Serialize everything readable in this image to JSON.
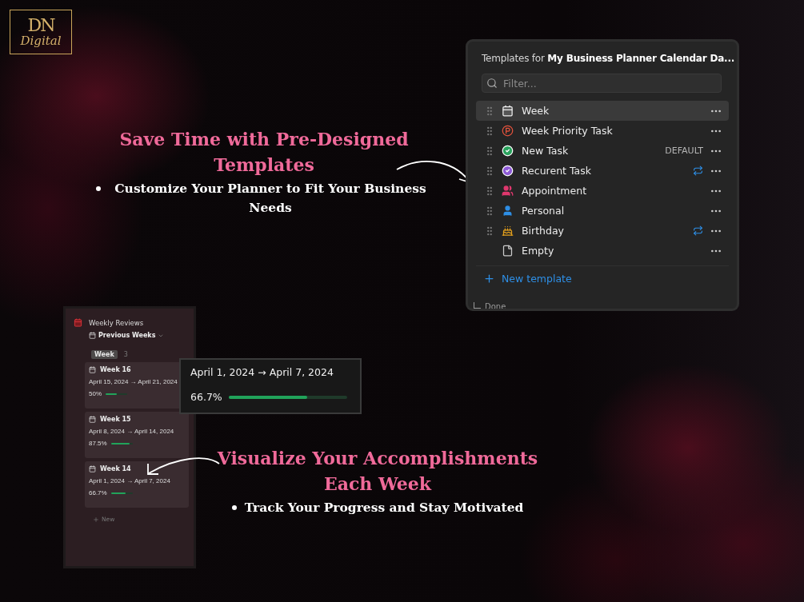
{
  "logo": {
    "monogram": "DN",
    "wordmark": "Digital"
  },
  "feature_1": {
    "heading": "Save Time with Pre-Designed Templates",
    "bullets": [
      "Customize Your Planner to Fit Your Business Needs"
    ]
  },
  "templates_panel": {
    "title_prefix": "Templates for",
    "title_database": "My Business Planner Calendar Da...",
    "filter": {
      "placeholder": "Filter..."
    },
    "templates": [
      {
        "label": "Week",
        "kind": "calendar",
        "selected": true,
        "draggable": true,
        "repeats": false
      },
      {
        "label": "Week Priority Task",
        "kind": "priority",
        "selected": false,
        "draggable": true,
        "repeats": false
      },
      {
        "label": "New Task",
        "kind": "task",
        "selected": false,
        "draggable": true,
        "repeats": false,
        "badge": "DEFAULT"
      },
      {
        "label": "Recurent Task",
        "kind": "recurring",
        "selected": false,
        "draggable": true,
        "repeats": true
      },
      {
        "label": "Appointment",
        "kind": "people",
        "selected": false,
        "draggable": true,
        "repeats": false
      },
      {
        "label": "Personal",
        "kind": "person",
        "selected": false,
        "draggable": true,
        "repeats": false
      },
      {
        "label": "Birthday",
        "kind": "cake",
        "selected": false,
        "draggable": true,
        "repeats": true
      },
      {
        "label": "Empty",
        "kind": "page",
        "selected": false,
        "draggable": false,
        "repeats": false
      }
    ],
    "new_template": "New template",
    "behind_text": "Done"
  },
  "weekly_panel": {
    "title": "Weekly Reviews",
    "view": "Previous Weeks",
    "group": {
      "label": "Week",
      "count": "3"
    },
    "cards": [
      {
        "title": "Week 16",
        "dates": "April 15, 2024 → April 21, 2024",
        "percent": "50%",
        "level": 0.5
      },
      {
        "title": "Week 15",
        "dates": "April 8, 2024 → April 14, 2024",
        "percent": "87.5%",
        "level": 0.875
      },
      {
        "title": "Week 14",
        "dates": "April 1, 2024 → April 7, 2024",
        "percent": "66.7%",
        "level": 0.667
      }
    ],
    "new": "New"
  },
  "zoom_card": {
    "dates": "April 1, 2024 → April 7, 2024",
    "percent": "66.7%",
    "level": 0.667
  },
  "feature_2": {
    "heading": "Visualize Your Accomplishments Each Week",
    "bullets": [
      "Track Your Progress and Stay Motivated"
    ]
  }
}
